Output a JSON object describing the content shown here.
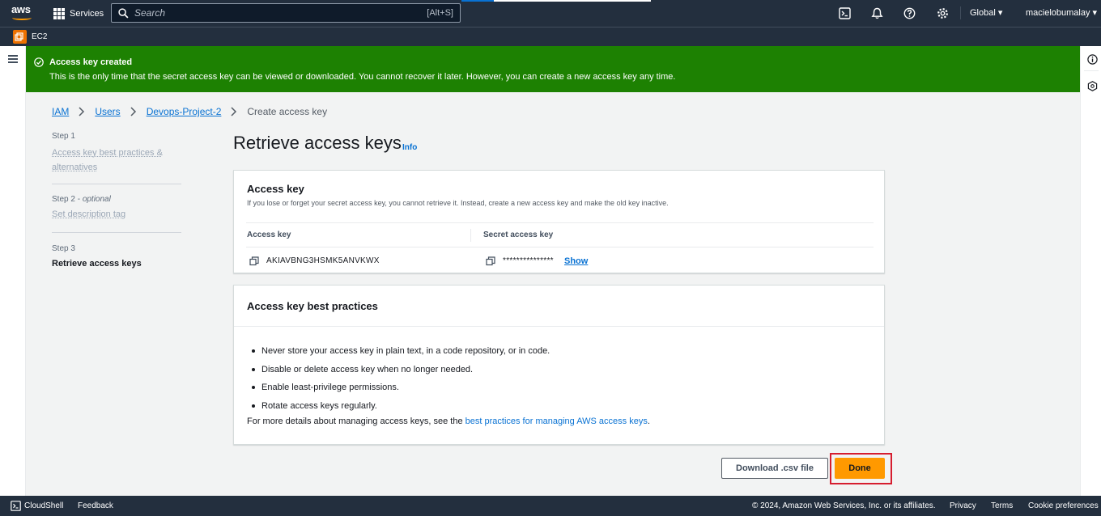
{
  "nav": {
    "logo": "aws",
    "services": "Services",
    "search_placeholder": "Search",
    "search_shortcut": "[Alt+S]",
    "region": "Global",
    "user": "macielobumalay",
    "icons": [
      "cloudshell-icon",
      "bell-icon",
      "help-icon",
      "settings-icon"
    ]
  },
  "subnav": {
    "service": "EC2"
  },
  "flash": {
    "title": "Access key created",
    "message": "This is the only time that the secret access key can be viewed or downloaded. You cannot recover it later. However, you can create a new access key any time.",
    "color": "#1d8102"
  },
  "breadcrumb": {
    "items": [
      "IAM",
      "Users",
      "Devops-Project-2"
    ],
    "current": "Create access key"
  },
  "steps": [
    {
      "label": "Step 1",
      "name": "Access key best practices & alternatives"
    },
    {
      "label": "Step 2",
      "optional": "optional",
      "name": "Set description tag"
    },
    {
      "label": "Step 3",
      "name": "Retrieve access keys"
    }
  ],
  "main": {
    "title": "Retrieve access keys",
    "info": "Info",
    "access_key_card": {
      "heading": "Access key",
      "description": "If you lose or forget your secret access key, you cannot retrieve it. Instead, create a new access key and make the old key inactive.",
      "col_access_key": "Access key",
      "col_secret_key": "Secret access key",
      "access_key_value": "AKIAVBNG3HSMK5ANVKWX",
      "secret_key_value": "***************",
      "show_label": "Show"
    },
    "best_practices_card": {
      "heading": "Access key best practices",
      "items": [
        "Never store your access key in plain text, in a code repository, or in code.",
        "Disable or delete access key when no longer needed.",
        "Enable least-privilege permissions.",
        "Rotate access keys regularly."
      ],
      "more_prefix": "For more details about managing access keys, see the ",
      "more_link": "best practices for managing AWS access keys",
      "more_suffix": "."
    },
    "download_button": "Download .csv file",
    "done_button": "Done"
  },
  "footer": {
    "cloudshell": "CloudShell",
    "feedback": "Feedback",
    "copyright": "© 2024, Amazon Web Services, Inc. or its affiliates.",
    "privacy": "Privacy",
    "terms": "Terms",
    "cookies": "Cookie preferences"
  },
  "colors": {
    "nav_bg": "#232f3e",
    "accent_orange": "#ff9900",
    "link_blue": "#0972d3",
    "success_green": "#1d8102",
    "highlight_red": "#d61d2f"
  }
}
